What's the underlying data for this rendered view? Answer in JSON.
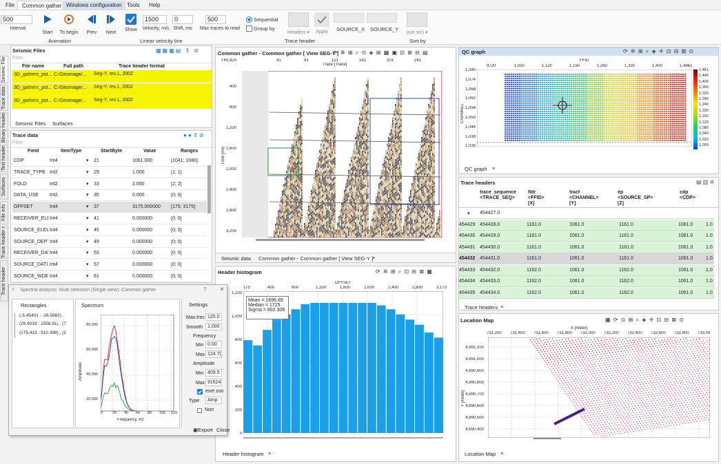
{
  "menu": [
    "File",
    "Common gather",
    "Windows configuration",
    "Tools",
    "Help"
  ],
  "ribbon": {
    "interval_value": "500",
    "interval_label": "Interval",
    "start": "Start",
    "to_begin": "To begin",
    "prev": "Prev",
    "next": "Next",
    "show": "Show",
    "animation_group": "Animation",
    "velocity_value": "1500",
    "velocity_label": "Velocity, m/s",
    "shift_value": "0",
    "shift_label": "Shift, ms",
    "max_traces_value": "500",
    "max_traces_label": "Max traces to read",
    "linear_velocity_group": "Linear velocity line",
    "sequential": "Sequential",
    "group_by": "Group by",
    "headers": "Headers ▾",
    "apply": "Apply",
    "source_x": "SOURCE_X",
    "source_y": "SOURCE_Y",
    "trace_header_group": "Trace header",
    "not_set": "(not set) ▾",
    "sort_by_group": "Sort by"
  },
  "seismic_files": {
    "title": "Seismic Files",
    "filter": "Filter",
    "columns": [
      "File name",
      "Full path",
      "Trace header format"
    ],
    "rows": [
      {
        "name": "3D_gathers_pst...",
        "path": "C:/Geomage/...",
        "format": "Seg-Y, rev.1, 2002"
      },
      {
        "name": "3D_gathers_pst...",
        "path": "C:/Geomage/...",
        "format": "Seg-Y, rev.1, 2002"
      },
      {
        "name": "3D_gathers_pst...",
        "path": "C:/Geomage/...",
        "format": "Seg-Y, rev.1, 2002"
      }
    ],
    "tabs": [
      "Seismic Files",
      "Surfaces"
    ]
  },
  "trace_data": {
    "title": "Trace data",
    "filter": "Filter",
    "columns": [
      "Field",
      "ItemType",
      "StartByte",
      "Value",
      "Ranges"
    ],
    "rows": [
      {
        "field": "CDP",
        "type": "Int4",
        "start": "21",
        "value": "1061.000",
        "range": "[1041; 1080]"
      },
      {
        "field": "TRACE_TYPE",
        "type": "Int2",
        "start": "29",
        "value": "1.000",
        "range": "[1; 1]"
      },
      {
        "field": "FOLD",
        "type": "Int2",
        "start": "33",
        "value": "2.000",
        "range": "[2; 2]"
      },
      {
        "field": "DATA_USE",
        "type": "Int2",
        "start": "35",
        "value": "0.000",
        "range": "[0; 0]"
      },
      {
        "field": "OFFSET",
        "type": "Int4",
        "start": "37",
        "value": "3175.000000",
        "range": "[175; 3175]"
      },
      {
        "field": "RECEIVER_ELE",
        "type": "Int4",
        "start": "41",
        "value": "0.000000",
        "range": "[0; 0]"
      },
      {
        "field": "SOURCE_ELEV",
        "type": "Int4",
        "start": "45",
        "value": "0.000000",
        "range": "[0; 0]"
      },
      {
        "field": "SOURCE_DEPT",
        "type": "Int4",
        "start": "49",
        "value": "0.000000",
        "range": "[0; 0]"
      },
      {
        "field": "RECEIVER_DAT",
        "type": "Int4",
        "start": "53",
        "value": "0.000000",
        "range": "[0; 0]"
      },
      {
        "field": "SOURCE_DATU",
        "type": "Int4",
        "start": "57",
        "value": "0.000000",
        "range": "[0; 0]"
      },
      {
        "field": "SOURCE_WDE",
        "type": "Int4",
        "start": "61",
        "value": "0.000000",
        "range": "[0; 0]"
      }
    ]
  },
  "side_tabs": [
    "Seismic Files",
    "Trace data",
    "Binary header",
    "Text header",
    "Surfaces",
    "File info",
    "Trace header ramp",
    "Trace header"
  ],
  "common_gather": {
    "title": "Common gather - Common gather [ View SEG-Y ]",
    "trcidx": "TRCIDX",
    "trace_axis": "Trace [Trace]",
    "time_axis": "Time [ms]",
    "x_ticks": [
      "41",
      "81",
      "121",
      "161",
      "201",
      "241"
    ],
    "y_ticks": [
      "400",
      "800",
      "1,200",
      "1,600",
      "2,000",
      "2,400",
      "2,800",
      "3,200"
    ],
    "tabs": [
      "Seismic data",
      "Common gather - Common gather [ View SEG-Y ]"
    ]
  },
  "qc_graph": {
    "title": "QC graph",
    "ffid": "FFID",
    "channel": "CHANNEL",
    "x_ticks": [
      "9720",
      "1,050",
      "1,120",
      "1,190",
      "1,260",
      "1,330",
      "1,400",
      "1,4861"
    ],
    "y_ticks": [
      "1,080",
      "1,074",
      "1,068",
      "1,062",
      "1,056",
      "1,050",
      "1,044",
      "1,038",
      "1,035"
    ],
    "scale": [
      "1,481",
      "1,440",
      "1,400",
      "1,360",
      "1,320",
      "1,280",
      "1,240",
      "1,200",
      "1,160",
      "1,120",
      "1,080",
      "1,040",
      "1,020",
      "1,000"
    ],
    "tab": "QC graph"
  },
  "trace_headers": {
    "title": "Trace headers",
    "columns": [
      [
        "trace_sequence",
        "<TRACE_SEQ>",
        ""
      ],
      [
        "fldr",
        "<FFID>",
        "[X]"
      ],
      [
        "tracf",
        "<CHANNEL>",
        "[Y]"
      ],
      [
        "ep",
        "<SOURCE_SP>",
        "[Z]"
      ],
      [
        "cdp",
        "<CDP>",
        ""
      ]
    ],
    "rows": [
      {
        "idx": "",
        "seq": "",
        "fldr": "",
        "tracf": "",
        "ep": "",
        "cdp": "",
        "x": ""
      },
      {
        "idx": "454429",
        "seq": "454428.0",
        "fldr": "1161.0",
        "tracf": "1061.0",
        "ep": "1161.0",
        "cdp": "1061.0",
        "x": "1.0"
      },
      {
        "idx": "454430",
        "seq": "454429.0",
        "fldr": "1161.0",
        "tracf": "1061.0",
        "ep": "1161.0",
        "cdp": "1061.0",
        "x": "1.0"
      },
      {
        "idx": "454431",
        "seq": "454430.0",
        "fldr": "1161.0",
        "tracf": "1061.0",
        "ep": "1161.0",
        "cdp": "1061.0",
        "x": "1.0"
      },
      {
        "idx": "454432",
        "seq": "454431.0",
        "fldr": "1161.0",
        "tracf": "1061.0",
        "ep": "1161.0",
        "cdp": "1061.0",
        "x": "1.0"
      },
      {
        "idx": "454433",
        "seq": "454432.0",
        "fldr": "1162.0",
        "tracf": "1061.0",
        "ep": "1162.0",
        "cdp": "1061.0",
        "x": "1.0"
      },
      {
        "idx": "454434",
        "seq": "454433.0",
        "fldr": "1162.0",
        "tracf": "1061.0",
        "ep": "1162.0",
        "cdp": "1061.0",
        "x": "1.0"
      },
      {
        "idx": "454435",
        "seq": "454434.0",
        "fldr": "1162.0",
        "tracf": "1061.0",
        "ep": "1162.0",
        "cdp": "1061.0",
        "x": "1.0"
      }
    ],
    "first_seq": "454427.0",
    "tab": "Trace headers"
  },
  "header_histogram": {
    "title": "Header histogram",
    "axis": "OFFSET",
    "x_ticks": [
      "175",
      "400",
      "800",
      "1,200",
      "1,600",
      "2,000",
      "2,400",
      "2,800",
      "3,173"
    ],
    "y_ticks": [
      "1,200",
      "1,000",
      "800",
      "600",
      "400",
      "200",
      "0"
    ],
    "stats": {
      "mean": "Mean = 1696.89",
      "median": "Median = 1725",
      "sigma": "Sigma = 802.308"
    },
    "tab": "Header histogram"
  },
  "chart_data": {
    "type": "bar",
    "values": [
      720,
      680,
      800,
      880,
      920,
      960,
      1000,
      1010,
      1010,
      1010,
      1010,
      1010,
      1010,
      1010,
      990,
      960,
      920,
      880,
      840,
      780,
      740
    ],
    "ylim": [
      0,
      1100
    ]
  },
  "location_map": {
    "title": "Location Map",
    "x_axis": "X [meter]",
    "y_axis": "Y [meter]",
    "x_ticks": [
      "731,200",
      "731,400",
      "731,600",
      "731,800",
      "732,000",
      "732,200",
      "732,400",
      "732,600",
      "732,800",
      "733,09"
    ],
    "y_ticks": [
      "4,891,100",
      "4,891,000",
      "4,890,900",
      "4,890,800",
      "4,890,700",
      "4,890,600",
      "4,890,500",
      "4,890,400"
    ],
    "tab": "Location Map"
  },
  "spectral": {
    "title": "Spectral analysis: Multi selection (Single view): Common gather",
    "rect_title": "Rectangles",
    "spectrum_title": "Spectrum",
    "settings_title": "Settings",
    "rects": [
      "(-5.45401 : -26.5982) ,",
      "(29.9233 : 1558.51) , (7",
      "(175.413 : 510.398) , (2"
    ],
    "amp_label": "Amplitude",
    "freq_label": "Frequency, Hz",
    "y_ticks": [
      "80,000",
      "60,000",
      "40,000",
      "20,000"
    ],
    "x_ticks": [
      "0",
      "20",
      "40",
      "60",
      "80",
      "100",
      "120"
    ],
    "max_freq_label": "Max.frec",
    "max_freq": "125.0",
    "smooth_label": "Smooth",
    "smooth": "1.000",
    "frequency": "Frequency",
    "min": "Min",
    "max": "Max",
    "fmin": "0.00",
    "fmax": "124.7(",
    "amplitude": "Amplitude",
    "amin": "409.5",
    "amax": "91624",
    "reset_zoom": "eset zoo",
    "type_label": "Type",
    "type_value": "Amp",
    "norm": "Norr",
    "export": "Export",
    "close": "Close"
  }
}
